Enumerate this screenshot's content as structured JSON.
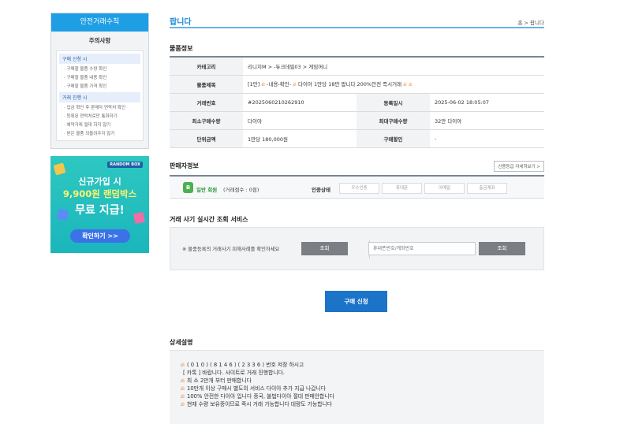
{
  "sidebar": {
    "safe_title": "안전거래수칙",
    "notice_title": "주의사항",
    "groups": [
      {
        "title": "구매 신청 시",
        "items": [
          "· 구매할 물품 수량 확인",
          "· 구매할 물품 내용 확인",
          "· 구매할 물품 가격 확인"
        ]
      },
      {
        "title": "거래 진행 시",
        "items": [
          "· 입금 확인 후 판매자 연락처 확인",
          "· 등록된 연락처로만 통화하기",
          "· 예약거래 절대 하지 않기",
          "· 받은 물품 되돌려주지 않기"
        ]
      }
    ],
    "banner": {
      "logo": "RANDOM BOX",
      "line1": "신규가입 시",
      "line2": "9,900원 랜덤박스",
      "line3": "무료 지급!",
      "button": "확인하기 >>"
    }
  },
  "header": {
    "title": "팝니다",
    "breadcrumb": "홈 > 팝니다"
  },
  "item_info": {
    "section_title": "물품정보",
    "category_label": "카테고리",
    "category_value": "리니지M > -듀크데필03 > 게임머니",
    "subject_label": "물품제목",
    "subject_prefix": "[1만]",
    "subject_part1": "-내용-확인-",
    "subject_part2": "다이아 1만당 18만 팝니다 200%안전 즉시거래",
    "trade_no_label": "거래번호",
    "trade_no_value": "#2025060210262910",
    "reg_date_label": "등록일시",
    "reg_date_value": "2025-06-02 18:05:07",
    "min_qty_label": "최소구매수량",
    "min_qty_value": "다이아",
    "max_qty_label": "최대구매수량",
    "max_qty_value": "32만 다이아",
    "unit_price_label": "단위금액",
    "unit_price_value": "1만당 180,000원",
    "discount_label": "구매할인",
    "discount_value": "-"
  },
  "seller_info": {
    "section_title": "판매자정보",
    "credit_button": "신용등급 자세히보기 >",
    "grade_badge": "B",
    "grade_label": "일반 회원",
    "grade_score": "(거래점수 : 0점)",
    "cert_label": "인증상태",
    "cert_items": [
      "우수인증",
      "휴대폰",
      "이메일",
      "출금계좌"
    ]
  },
  "fraud_check": {
    "section_title": "거래 사기 실시간 조회 서비스",
    "note": "※ 물품등록의 거래사기 피해사례를 확인하세요",
    "lookup_button": "조회",
    "phone_placeholder": "휴대폰번호/계좌번호",
    "lookup_button2": "조회"
  },
  "buy_button": "구매 신청",
  "detail": {
    "section_title": "상세설명",
    "lines": [
      "( 0 1 0 )   ( 8 1 4 6 )   ( 2 3 3 6 ) 번호  저장  하시고",
      "[ 카톡 ]   바랍니다. 사이트로   거래   진행합니다.",
      "최 소 2만개 부터 판매합니다",
      "10만개 이상 구매시 별도의 서비스 다이아 추가 지급 나갑니다",
      "100% 안전한 다이아 입니다 중국, 불법다이아 절대 판매안합니다",
      "현재 수량 보유중이므로 즉시 거래 가능합니다 대량도 가능합니다"
    ],
    "line_has_fire": [
      true,
      false,
      true,
      true,
      true,
      true
    ]
  },
  "colors": {
    "accent": "#1c8ad6",
    "sidebar_header": "#1e9ee5",
    "buy_button": "#1c74c9",
    "fire": "#f06a1a"
  },
  "icons": {
    "fire": "fire-icon",
    "grade": "grade-b-badge-icon"
  }
}
